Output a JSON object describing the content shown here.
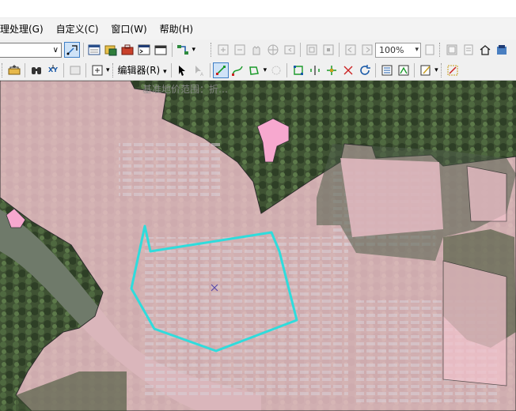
{
  "menu": {
    "items": [
      "理处理(G)",
      "自定义(C)",
      "窗口(W)",
      "帮助(H)"
    ]
  },
  "toolbar1": {
    "layer_combo_arrow": "∨",
    "scale_value": "100%",
    "icons": [
      "select-features-icon",
      "table-window-icon",
      "catalog-icon",
      "toolbox-icon",
      "python-icon",
      "command-line-icon",
      "model-builder-icon",
      "zoom-in-fixed-icon",
      "zoom-out-fixed-icon",
      "pan-icon",
      "full-extent-icon",
      "previous-extent-icon",
      "layout-zoom-in-icon",
      "layout-zoom-out-icon",
      "layout-pan-icon",
      "layout-whole-page-icon",
      "layout-icon",
      "data-view-icon",
      "layout-view-icon"
    ]
  },
  "toolbar2": {
    "editor_label": "编辑器(R)",
    "icons": [
      "add-data-icon",
      "find-icon",
      "xy-icon",
      "layer-icon",
      "zoom-to-icon",
      "edit-tool-icon",
      "edit-annotation-icon",
      "straight-segment-icon",
      "curve-icon",
      "trace-icon",
      "vertex-icon",
      "cut-polygon-icon",
      "split-icon",
      "rotate-icon",
      "reshape-icon",
      "attributes-icon",
      "sketch-properties-icon",
      "create-features-icon",
      "topology-icon"
    ]
  },
  "map": {
    "caption": "基准地价范围：折…",
    "polygon_stroke": "#2fdcdc",
    "overlay_fill": "#f4c6d2",
    "highlight_fill": "#f7a8cf"
  }
}
